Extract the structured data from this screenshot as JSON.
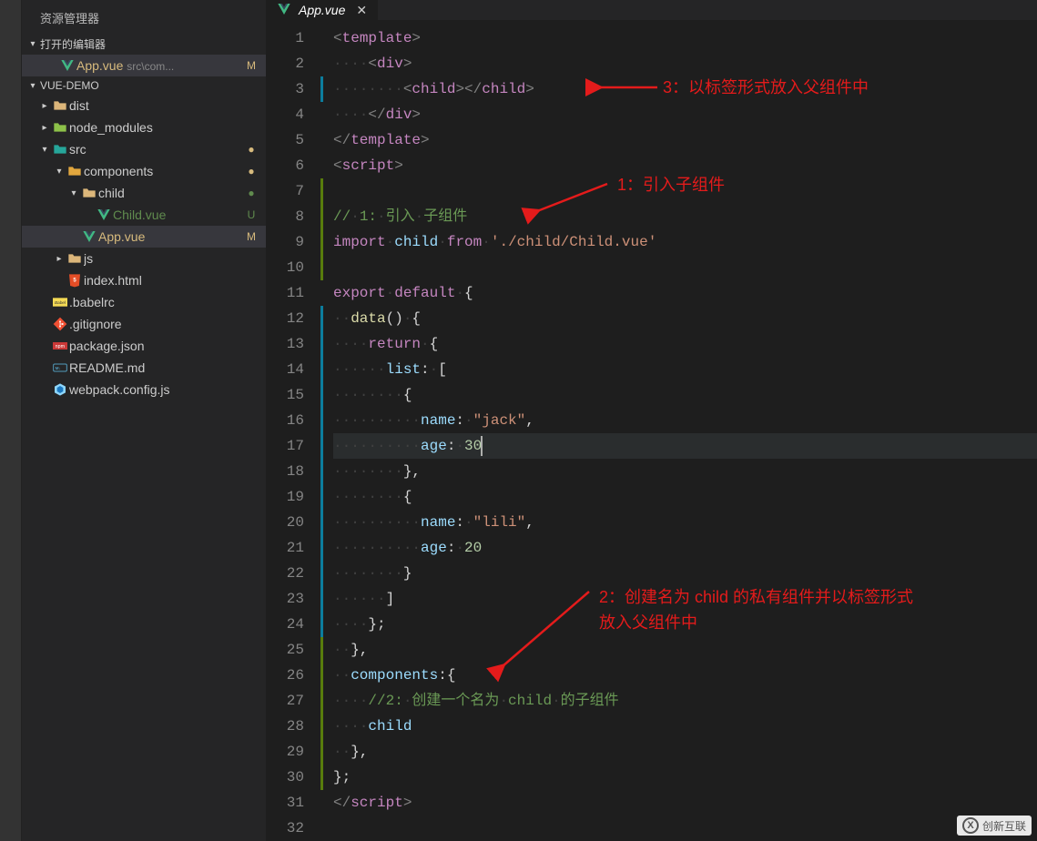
{
  "sidebar": {
    "title": "资源管理器",
    "openEditors": {
      "label": "打开的编辑器",
      "items": [
        {
          "name": "App.vue",
          "path": "src\\com...",
          "status": "M"
        }
      ]
    },
    "project": {
      "name": "VUE-DEMO",
      "tree": [
        {
          "type": "folder",
          "name": "dist",
          "depth": 1,
          "expanded": false,
          "icon": "folder-yellow"
        },
        {
          "type": "folder",
          "name": "node_modules",
          "depth": 1,
          "expanded": false,
          "icon": "folder-green"
        },
        {
          "type": "folder",
          "name": "src",
          "depth": 1,
          "expanded": true,
          "icon": "folder-teal",
          "git": "dot-mod"
        },
        {
          "type": "folder",
          "name": "components",
          "depth": 2,
          "expanded": true,
          "icon": "folder-orange",
          "git": "dot-mod"
        },
        {
          "type": "folder",
          "name": "child",
          "depth": 3,
          "expanded": true,
          "icon": "folder-yellow",
          "git": "dot-unt"
        },
        {
          "type": "file",
          "name": "Child.vue",
          "depth": 4,
          "icon": "vue",
          "gitLetter": "U",
          "gitClass": "git-U",
          "color": "#608b4e"
        },
        {
          "type": "file",
          "name": "App.vue",
          "depth": 3,
          "icon": "vue",
          "gitLetter": "M",
          "gitClass": "git-M",
          "color": "#d7ba7d",
          "selected": true
        },
        {
          "type": "folder",
          "name": "js",
          "depth": 2,
          "expanded": false,
          "icon": "folder-yellow"
        },
        {
          "type": "file",
          "name": "index.html",
          "depth": 2,
          "icon": "html"
        },
        {
          "type": "file",
          "name": ".babelrc",
          "depth": 1,
          "icon": "babel"
        },
        {
          "type": "file",
          "name": ".gitignore",
          "depth": 1,
          "icon": "git"
        },
        {
          "type": "file",
          "name": "package.json",
          "depth": 1,
          "icon": "npm"
        },
        {
          "type": "file",
          "name": "README.md",
          "depth": 1,
          "icon": "md"
        },
        {
          "type": "file",
          "name": "webpack.config.js",
          "depth": 1,
          "icon": "webpack"
        }
      ]
    }
  },
  "tab": {
    "name": "App.vue"
  },
  "annotations": {
    "a1": "1：引入子组件",
    "a2_line1": "2：创建名为 child 的私有组件并以标签形式",
    "a2_line2": "放入父组件中",
    "a3": "3：以标签形式放入父组件中"
  },
  "code": {
    "lines": [
      {
        "n": 1,
        "git": "",
        "html": "<span class='mtk-gray'>&lt;</span><span class='mtk-tag'>template</span><span class='mtk-gray'>&gt;</span>"
      },
      {
        "n": 2,
        "git": "",
        "html": "<span class='whitespace-dot'>····</span><span class='mtk-gray'>&lt;</span><span class='mtk-tag'>div</span><span class='mtk-gray'>&gt;</span>"
      },
      {
        "n": 3,
        "git": "blue",
        "html": "<span class='whitespace-dot'>········</span><span class='mtk-gray'>&lt;</span><span class='mtk-tag'>child</span><span class='mtk-gray'>&gt;&lt;/</span><span class='mtk-tag'>child</span><span class='mtk-gray'>&gt;</span>"
      },
      {
        "n": 4,
        "git": "",
        "html": "<span class='whitespace-dot'>····</span><span class='mtk-gray'>&lt;/</span><span class='mtk-tag'>div</span><span class='mtk-gray'>&gt;</span>"
      },
      {
        "n": 5,
        "git": "",
        "html": "<span class='mtk-gray'>&lt;/</span><span class='mtk-tag'>template</span><span class='mtk-gray'>&gt;</span>"
      },
      {
        "n": 6,
        "git": "",
        "html": "<span class='mtk-gray'>&lt;</span><span class='mtk-tag'>script</span><span class='mtk-gray'>&gt;</span>"
      },
      {
        "n": 7,
        "git": "green",
        "html": ""
      },
      {
        "n": 8,
        "git": "green",
        "html": "<span class='mtk-cmt'>//</span><span class='whitespace-dot'>·</span><span class='mtk-cmt'>1:</span><span class='whitespace-dot'>·</span><span class='mtk-cmt'>引入</span><span class='whitespace-dot'>·</span><span class='mtk-cmt'>子组件</span>"
      },
      {
        "n": 9,
        "git": "green",
        "html": "<span class='mtk-kw'>import</span><span class='whitespace-dot'>·</span><span class='mtk-var'>child</span><span class='whitespace-dot'>·</span><span class='mtk-kw'>from</span><span class='whitespace-dot'>·</span><span class='mtk-str'>'./child/Child.vue'</span>"
      },
      {
        "n": 10,
        "git": "green",
        "html": ""
      },
      {
        "n": 11,
        "git": "",
        "html": "<span class='mtk-kw'>export</span><span class='whitespace-dot'>·</span><span class='mtk-kw'>default</span><span class='whitespace-dot'>·</span><span class='mtk-white'>{</span>"
      },
      {
        "n": 12,
        "git": "blue",
        "html": "<span class='whitespace-dot'>··</span><span class='mtk-func'>data</span><span class='mtk-white'>()</span><span class='whitespace-dot'>·</span><span class='mtk-white'>{</span>"
      },
      {
        "n": 13,
        "git": "blue",
        "html": "<span class='whitespace-dot'>····</span><span class='mtk-kw'>return</span><span class='whitespace-dot'>·</span><span class='mtk-white'>{</span>"
      },
      {
        "n": 14,
        "git": "blue",
        "html": "<span class='whitespace-dot'>······</span><span class='mtk-var'>list</span><span class='mtk-white'>:</span><span class='whitespace-dot'>·</span><span class='mtk-white'>[</span>"
      },
      {
        "n": 15,
        "git": "blue",
        "html": "<span class='whitespace-dot'>········</span><span class='mtk-white'>{</span>"
      },
      {
        "n": 16,
        "git": "blue",
        "html": "<span class='whitespace-dot'>··········</span><span class='mtk-var'>name</span><span class='mtk-white'>:</span><span class='whitespace-dot'>·</span><span class='mtk-str'>\"jack\"</span><span class='mtk-white'>,</span>"
      },
      {
        "n": 17,
        "git": "blue",
        "current": true,
        "html": "<span class='whitespace-dot'>··········</span><span class='mtk-var'>age</span><span class='mtk-white'>:</span><span class='whitespace-dot'>·</span><span class='mtk-num'>30</span><span class='cursor'></span>"
      },
      {
        "n": 18,
        "git": "blue",
        "html": "<span class='whitespace-dot'>········</span><span class='mtk-white'>},</span>"
      },
      {
        "n": 19,
        "git": "blue",
        "html": "<span class='whitespace-dot'>········</span><span class='mtk-white'>{</span>"
      },
      {
        "n": 20,
        "git": "blue",
        "html": "<span class='whitespace-dot'>··········</span><span class='mtk-var'>name</span><span class='mtk-white'>:</span><span class='whitespace-dot'>·</span><span class='mtk-str'>\"lili\"</span><span class='mtk-white'>,</span>"
      },
      {
        "n": 21,
        "git": "blue",
        "html": "<span class='whitespace-dot'>··········</span><span class='mtk-var'>age</span><span class='mtk-white'>:</span><span class='whitespace-dot'>·</span><span class='mtk-num'>20</span>"
      },
      {
        "n": 22,
        "git": "blue",
        "html": "<span class='whitespace-dot'>········</span><span class='mtk-white'>}</span>"
      },
      {
        "n": 23,
        "git": "blue",
        "html": "<span class='whitespace-dot'>······</span><span class='mtk-white'>]</span>"
      },
      {
        "n": 24,
        "git": "blue",
        "html": "<span class='whitespace-dot'>····</span><span class='mtk-white'>};</span>"
      },
      {
        "n": 25,
        "git": "green",
        "html": "<span class='whitespace-dot'>··</span><span class='mtk-white'>},</span>"
      },
      {
        "n": 26,
        "git": "green",
        "html": "<span class='whitespace-dot'>··</span><span class='mtk-var'>components</span><span class='mtk-white'>:{</span>"
      },
      {
        "n": 27,
        "git": "green",
        "html": "<span class='whitespace-dot'>····</span><span class='mtk-cmt'>//2:</span><span class='whitespace-dot'>·</span><span class='mtk-cmt'>创建一个名为</span><span class='whitespace-dot'>·</span><span class='mtk-cmt'>child</span><span class='whitespace-dot'>·</span><span class='mtk-cmt'>的子组件</span>"
      },
      {
        "n": 28,
        "git": "green",
        "html": "<span class='whitespace-dot'>····</span><span class='mtk-var'>child</span>"
      },
      {
        "n": 29,
        "git": "green",
        "html": "<span class='whitespace-dot'>··</span><span class='mtk-white'>},</span>"
      },
      {
        "n": 30,
        "git": "green",
        "html": "<span class='mtk-white'>};</span>"
      },
      {
        "n": 31,
        "git": "",
        "html": "<span class='mtk-gray'>&lt;/</span><span class='mtk-tag'>script</span><span class='mtk-gray'>&gt;</span>"
      },
      {
        "n": 32,
        "git": "",
        "html": ""
      }
    ]
  },
  "watermark": "创新互联"
}
